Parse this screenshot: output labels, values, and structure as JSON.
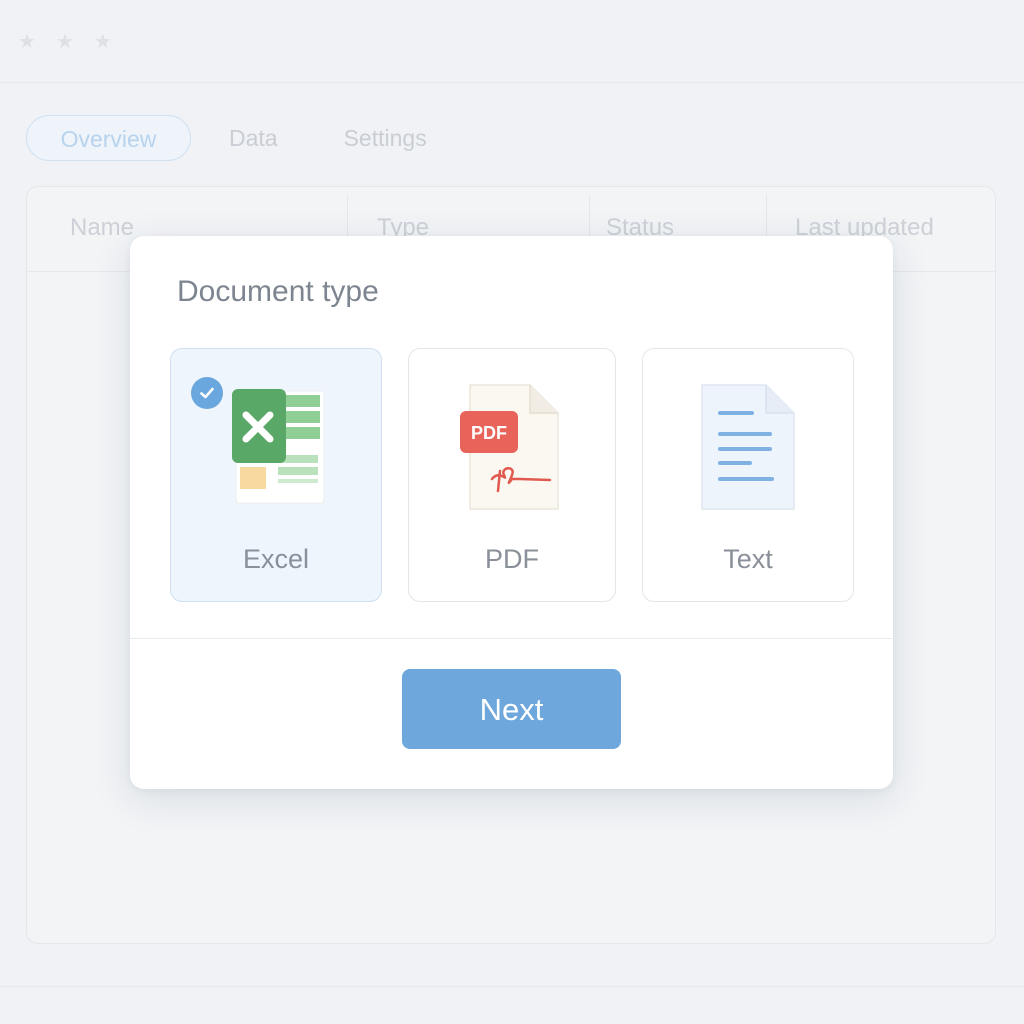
{
  "app": {
    "window_controls": [
      "star-icon",
      "star-icon",
      "star-icon"
    ],
    "tabs": [
      {
        "label": "Overview",
        "active": true
      },
      {
        "label": "Data",
        "active": false
      },
      {
        "label": "Settings",
        "active": false
      }
    ],
    "table": {
      "columns": [
        "Name",
        "Type",
        "Status",
        "Last updated"
      ]
    }
  },
  "dialog": {
    "title": "Document type",
    "options": [
      {
        "label": "Excel",
        "icon": "excel-file-icon",
        "selected": true
      },
      {
        "label": "PDF",
        "icon": "pdf-file-icon",
        "selected": false,
        "badge": "PDF"
      },
      {
        "label": "Text",
        "icon": "text-file-icon",
        "selected": false
      }
    ],
    "next_label": "Next"
  },
  "colors": {
    "accent": "#6ea7db",
    "excel_green": "#5aa867",
    "pdf_red": "#e8645a"
  }
}
